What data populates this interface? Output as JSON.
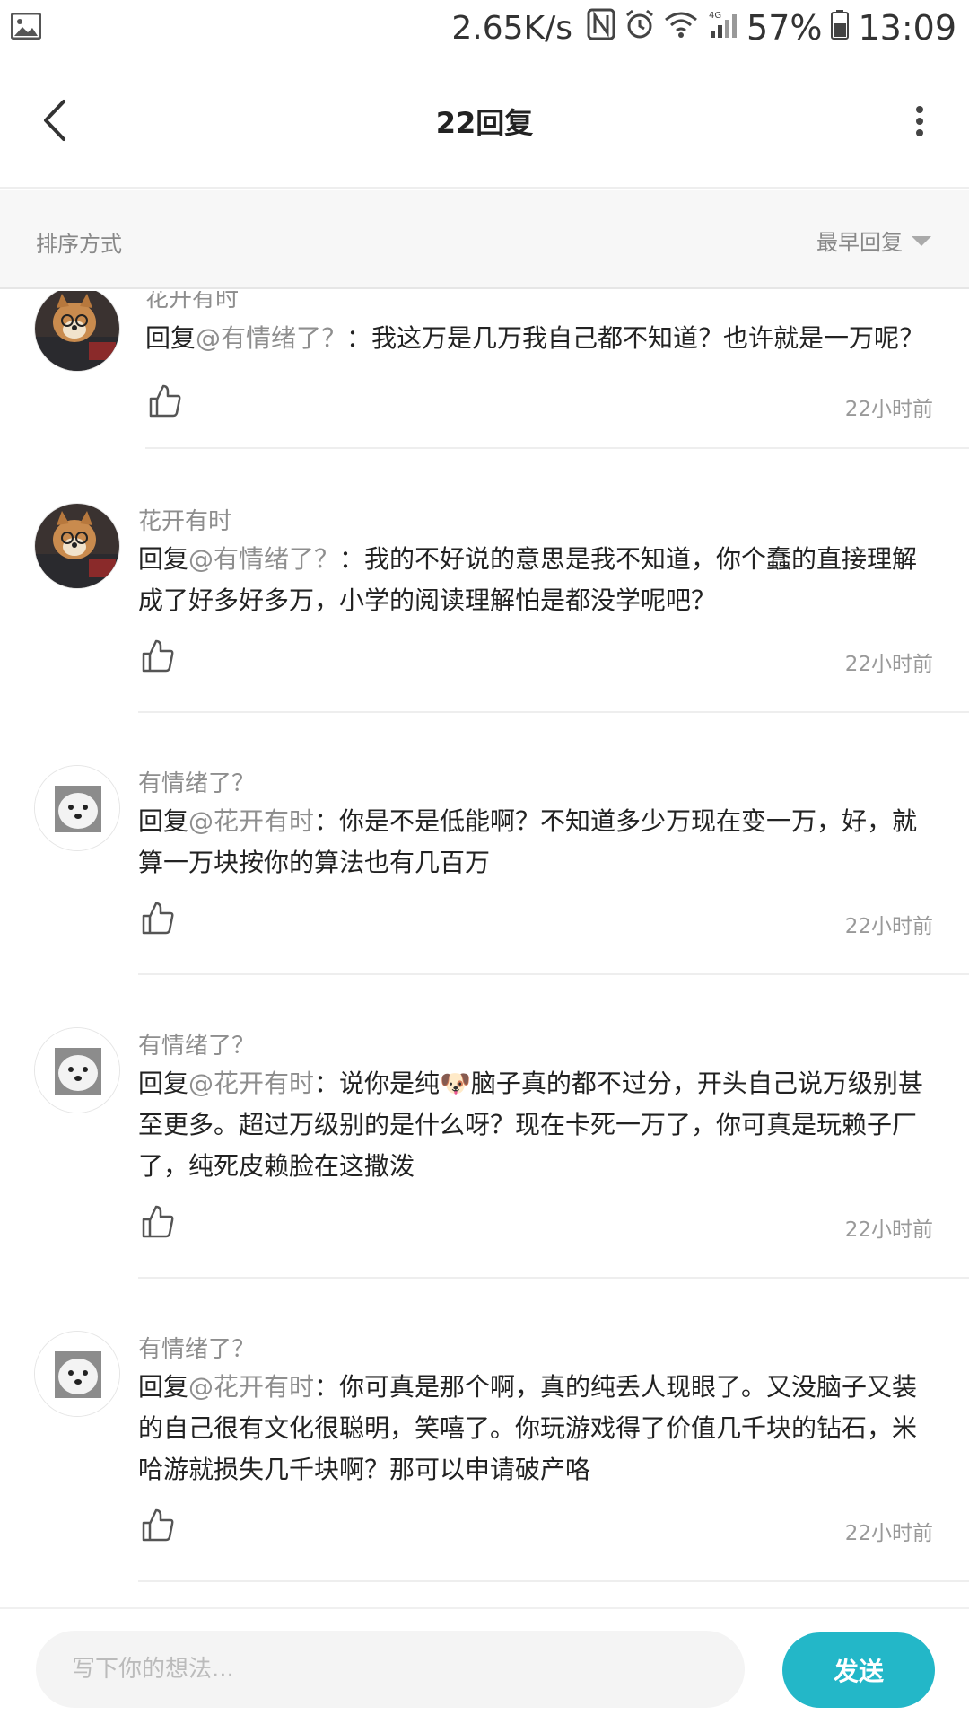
{
  "status_bar": {
    "speed": "2.65K/s",
    "battery": "57%",
    "time": "13:09",
    "network": "4G"
  },
  "header": {
    "title": "22回复"
  },
  "sort": {
    "label": "排序方式",
    "selected": "最早回复"
  },
  "comments": [
    {
      "username": "花开有时",
      "reply_prefix": "回复",
      "mention": "@有情绪了？",
      "text": "：我这万是几万我自己都不知道？也许就是一万呢？",
      "time": "22小时前",
      "avatar": "shiba-avatar"
    },
    {
      "username": "花开有时",
      "reply_prefix": "回复",
      "mention": "@有情绪了？",
      "text": "：我的不好说的意思是我不知道，你个蠢的直接理解成了好多好多万，小学的阅读理解怕是都没学呢吧？",
      "time": "22小时前",
      "avatar": "shiba-avatar"
    },
    {
      "username": "有情绪了？",
      "reply_prefix": "回复",
      "mention": "@花开有时",
      "text": "：你是不是低能啊？不知道多少万现在变一万，好，就算一万块按你的算法也有几百万",
      "time": "22小时前",
      "avatar": "dog-avatar"
    },
    {
      "username": "有情绪了？",
      "reply_prefix": "回复",
      "mention": "@花开有时",
      "text": "：说你是纯🐶脑子真的都不过分，开头自己说万级别甚至更多。超过万级别的是什么呀？现在卡死一万了，你可真是玩赖子厂了，纯死皮赖脸在这撒泼",
      "time": "22小时前",
      "avatar": "dog-avatar"
    },
    {
      "username": "有情绪了？",
      "reply_prefix": "回复",
      "mention": "@花开有时",
      "text": "：你可真是那个啊，真的纯丢人现眼了。又没脑子又装的自己很有文化很聪明，笑嘻了。你玩游戏得了价值几千块的钻石，米哈游就损失几千块啊？那可以申请破产咯",
      "time": "22小时前",
      "avatar": "dog-avatar"
    }
  ],
  "composer": {
    "placeholder": "写下你的想法...",
    "send_label": "发送"
  },
  "colors": {
    "accent": "#23b7c8",
    "muted": "#8e8e8e"
  }
}
